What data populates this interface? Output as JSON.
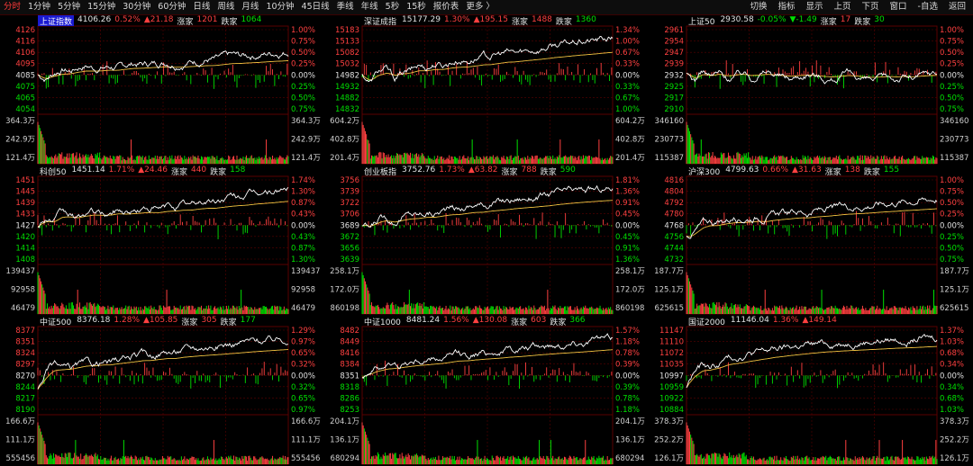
{
  "toolbar": {
    "tabs": [
      "分时",
      "1分钟",
      "5分钟",
      "15分钟",
      "30分钟",
      "60分钟",
      "日线",
      "周线",
      "月线",
      "10分钟",
      "45日线",
      "季线",
      "年线",
      "5秒",
      "15秒",
      "报价表",
      "更多 〉"
    ],
    "active_tab": "分时",
    "right": [
      "切换",
      "指标",
      "显示",
      "上页",
      "下页",
      "窗口",
      "-自选",
      "返回"
    ]
  },
  "colors": {
    "up": "#ff4040",
    "down": "#00e000",
    "price_line": "#ffffff",
    "avg_line": "#f0c040",
    "grid": "#5a0000"
  },
  "panels": [
    {
      "name": "上证指数",
      "highlight": true,
      "price": "4106.26",
      "pct": "0.52%",
      "chg": "▲21.18",
      "chg_dir": "up",
      "rise_label": "涨家",
      "rise": "1201",
      "fall_label": "跌家",
      "fall": "1064",
      "left_price": [
        "4126",
        "4116",
        "4106",
        "4095",
        "4085",
        "4075",
        "4065",
        "4054"
      ],
      "right_pct": [
        "1.00%",
        "0.75%",
        "0.50%",
        "0.25%",
        "0.00%",
        "0.25%",
        "0.50%",
        "0.75%"
      ],
      "vol_left": [
        "364.3万",
        "242.9万",
        "121.4万"
      ],
      "vol_right": [
        "364.3万",
        "242.9万",
        "121.4万"
      ],
      "trend": [
        0,
        -0.1,
        0.05,
        0.15,
        0.1,
        0.2,
        0.25,
        0.18,
        0.2,
        0.22,
        0.18,
        0.25,
        0.3,
        0.28,
        0.3,
        0.32,
        0.35,
        0.3,
        0.32,
        0.36,
        0.38,
        0.42,
        0.4,
        0.45,
        0.5,
        0.48,
        0.5,
        0.52,
        0.55,
        0.58,
        0.6,
        0.62
      ]
    },
    {
      "name": "深证成指",
      "highlight": false,
      "price": "15177.29",
      "pct": "1.30%",
      "chg": "▲195.15",
      "chg_dir": "up",
      "rise_label": "涨家",
      "rise": "1488",
      "fall_label": "跌家",
      "fall": "1360",
      "left_price": [
        "15183",
        "15133",
        "15082",
        "15032",
        "14982",
        "14932",
        "14882",
        "14832"
      ],
      "right_pct": [
        "1.34%",
        "1.00%",
        "0.67%",
        "0.33%",
        "0.00%",
        "0.33%",
        "0.67%",
        "1.00%"
      ],
      "vol_left": [
        "604.2万",
        "402.8万",
        "201.4万"
      ],
      "vol_right": [
        "604.2万",
        "402.8万",
        "201.4万"
      ],
      "trend": [
        0,
        -0.2,
        0.1,
        0.15,
        -0.1,
        0.05,
        0.1,
        0.25,
        0.2,
        0.3,
        0.25,
        0.35,
        0.4,
        0.38,
        0.45,
        0.5,
        0.48,
        0.55,
        0.6,
        0.58,
        0.62,
        0.66,
        0.7,
        0.75,
        0.8,
        0.82,
        0.85,
        0.88,
        0.9,
        0.92,
        0.95,
        0.98
      ]
    },
    {
      "name": "上证50",
      "highlight": false,
      "price": "2930.58",
      "pct": "-0.05%",
      "chg": "▼-1.49",
      "chg_dir": "down",
      "rise_label": "涨家",
      "rise": "17",
      "fall_label": "跌家",
      "fall": "30",
      "left_price": [
        "2961",
        "2954",
        "2947",
        "2939",
        "2932",
        "2925",
        "2917",
        "2910"
      ],
      "right_pct": [
        "1.00%",
        "0.75%",
        "0.50%",
        "0.25%",
        "0.00%",
        "0.25%",
        "0.50%",
        "0.75%"
      ],
      "vol_left": [
        "346160",
        "230773",
        "115387"
      ],
      "vol_right": [
        "346160",
        "230773",
        "115387"
      ],
      "trend": [
        0,
        -0.15,
        0.1,
        -0.05,
        0.05,
        -0.1,
        0,
        0.08,
        -0.05,
        0.05,
        0.1,
        0.02,
        -0.05,
        -0.1,
        -0.02,
        0.05,
        0,
        -0.08,
        -0.12,
        -0.05,
        0.02,
        -0.03,
        -0.1,
        -0.15,
        -0.12,
        -0.08,
        -0.1,
        -0.05,
        -0.08,
        -0.02,
        0.02,
        0.05
      ]
    },
    {
      "name": "科创50",
      "highlight": false,
      "price": "1451.14",
      "pct": "1.71%",
      "chg": "▲24.46",
      "chg_dir": "up",
      "rise_label": "涨家",
      "rise": "440",
      "fall_label": "跌家",
      "fall": "158",
      "left_price": [
        "1451",
        "1445",
        "1439",
        "1433",
        "1427",
        "1420",
        "1414",
        "1408"
      ],
      "right_pct": [
        "1.74%",
        "1.30%",
        "0.87%",
        "0.43%",
        "0.00%",
        "0.43%",
        "0.87%",
        "1.30%"
      ],
      "vol_left": [
        "139437",
        "92958",
        "46479"
      ],
      "vol_right": [
        "139437",
        "92958",
        "46479"
      ],
      "trend": [
        0,
        0.2,
        0.1,
        0.3,
        0.25,
        0.15,
        0.3,
        0.35,
        0.28,
        0.3,
        0.4,
        0.35,
        0.38,
        0.42,
        0.45,
        0.4,
        0.48,
        0.5,
        0.55,
        0.52,
        0.6,
        0.65,
        0.62,
        0.7,
        0.75,
        0.78,
        0.8,
        0.85,
        0.88,
        0.9,
        0.95,
        0.98
      ]
    },
    {
      "name": "创业板指",
      "highlight": false,
      "price": "3752.76",
      "pct": "1.73%",
      "chg": "▲63.82",
      "chg_dir": "up",
      "rise_label": "涨家",
      "rise": "788",
      "fall_label": "跌家",
      "fall": "590",
      "left_price": [
        "3756",
        "3739",
        "3722",
        "3706",
        "3689",
        "3672",
        "3656",
        "3639"
      ],
      "right_pct": [
        "1.81%",
        "1.36%",
        "0.91%",
        "0.45%",
        "0.00%",
        "0.45%",
        "0.91%",
        "1.36%"
      ],
      "vol_left": [
        "258.1万",
        "172.0万",
        "860198"
      ],
      "vol_right": [
        "258.1万",
        "172.0万",
        "860198"
      ],
      "trend": [
        0,
        -0.1,
        0.15,
        0.2,
        0.1,
        0.25,
        0.3,
        0.28,
        0.35,
        0.32,
        0.4,
        0.45,
        0.42,
        0.5,
        0.55,
        0.52,
        0.6,
        0.62,
        0.65,
        0.7,
        0.72,
        0.75,
        0.78,
        0.8,
        0.85,
        0.88,
        0.9,
        0.92,
        0.94,
        0.95,
        0.97,
        0.98
      ]
    },
    {
      "name": "沪深300",
      "highlight": false,
      "price": "4799.63",
      "pct": "0.66%",
      "chg": "▲31.63",
      "chg_dir": "up",
      "rise_label": "涨家",
      "rise": "138",
      "fall_label": "跌家",
      "fall": "155",
      "left_price": [
        "4816",
        "4804",
        "4792",
        "4780",
        "4768",
        "4756",
        "4744",
        "4732"
      ],
      "right_pct": [
        "1.00%",
        "0.75%",
        "0.50%",
        "0.25%",
        "0.00%",
        "0.25%",
        "0.50%",
        "0.75%"
      ],
      "vol_left": [
        "187.7万",
        "125.1万",
        "625615"
      ],
      "vol_right": [
        "187.7万",
        "125.1万",
        "625615"
      ],
      "trend": [
        -0.3,
        -0.15,
        0.05,
        0.1,
        0.05,
        0.15,
        0.2,
        0.18,
        0.2,
        0.25,
        0.22,
        0.28,
        0.3,
        0.32,
        0.35,
        0.33,
        0.38,
        0.4,
        0.42,
        0.45,
        0.48,
        0.5,
        0.52,
        0.55,
        0.58,
        0.6,
        0.62,
        0.65,
        0.66,
        0.68,
        0.7,
        0.72
      ]
    },
    {
      "name": "中证500",
      "highlight": false,
      "price": "8376.18",
      "pct": "1.28%",
      "chg": "▲105.85",
      "chg_dir": "up",
      "rise_label": "涨家",
      "rise": "305",
      "fall_label": "跌家",
      "fall": "177",
      "left_price": [
        "8377",
        "8351",
        "8324",
        "8297",
        "8270",
        "8244",
        "8217",
        "8190"
      ],
      "right_pct": [
        "1.29%",
        "0.97%",
        "0.65%",
        "0.32%",
        "0.00%",
        "0.32%",
        "0.65%",
        "0.97%"
      ],
      "vol_left": [
        "166.6万",
        "111.1万",
        "555456"
      ],
      "vol_right": [
        "166.6万",
        "111.1万",
        "555456"
      ],
      "trend": [
        -0.4,
        0.1,
        0.3,
        0.2,
        0.15,
        0.25,
        0.3,
        0.28,
        0.35,
        0.32,
        0.4,
        0.45,
        0.5,
        0.55,
        0.52,
        0.6,
        0.65,
        0.62,
        0.7,
        0.72,
        0.75,
        0.78,
        0.8,
        0.82,
        0.85,
        0.88,
        0.9,
        0.92,
        0.94,
        0.95,
        0.97,
        0.99
      ]
    },
    {
      "name": "中证1000",
      "highlight": false,
      "price": "8481.24",
      "pct": "1.56%",
      "chg": "▲130.08",
      "chg_dir": "up",
      "rise_label": "涨家",
      "rise": "603",
      "fall_label": "跌家",
      "fall": "366",
      "left_price": [
        "8482",
        "8449",
        "8416",
        "8384",
        "8351",
        "8318",
        "8286",
        "8253"
      ],
      "right_pct": [
        "1.57%",
        "1.18%",
        "0.78%",
        "0.39%",
        "0.00%",
        "0.39%",
        "0.78%",
        "1.18%"
      ],
      "vol_left": [
        "204.1万",
        "136.1万",
        "680294"
      ],
      "vol_right": [
        "204.1万",
        "136.1万",
        "680294"
      ],
      "trend": [
        0,
        0.15,
        0.2,
        0.3,
        0.25,
        0.3,
        0.35,
        0.38,
        0.4,
        0.42,
        0.45,
        0.5,
        0.55,
        0.52,
        0.58,
        0.6,
        0.62,
        0.65,
        0.68,
        0.7,
        0.72,
        0.75,
        0.78,
        0.8,
        0.83,
        0.86,
        0.88,
        0.9,
        0.93,
        0.95,
        0.97,
        0.99
      ]
    },
    {
      "name": "国证2000",
      "highlight": false,
      "price": "11146.04",
      "pct": "1.36%",
      "chg": "▲149.14",
      "chg_dir": "up",
      "rise_label": "",
      "rise": "",
      "fall_label": "",
      "fall": "",
      "left_price": [
        "11147",
        "11110",
        "11072",
        "11035",
        "10997",
        "10959",
        "10922",
        "10884"
      ],
      "right_pct": [
        "1.37%",
        "1.03%",
        "0.68%",
        "0.34%",
        "0.00%",
        "0.34%",
        "0.68%",
        "1.03%"
      ],
      "vol_left": [
        "378.3万",
        "252.2万",
        "126.1万"
      ],
      "vol_right": [
        "378.3万",
        "252.2万",
        "126.1万"
      ],
      "trend": [
        -0.3,
        0.1,
        0.25,
        0.2,
        0.3,
        0.45,
        0.5,
        0.55,
        0.6,
        0.62,
        0.65,
        0.7,
        0.72,
        0.75,
        0.78,
        0.8,
        0.82,
        0.84,
        0.85,
        0.87,
        0.88,
        0.9,
        0.91,
        0.92,
        0.93,
        0.94,
        0.95,
        0.96,
        0.97,
        0.98,
        0.99,
        1.0
      ]
    }
  ]
}
